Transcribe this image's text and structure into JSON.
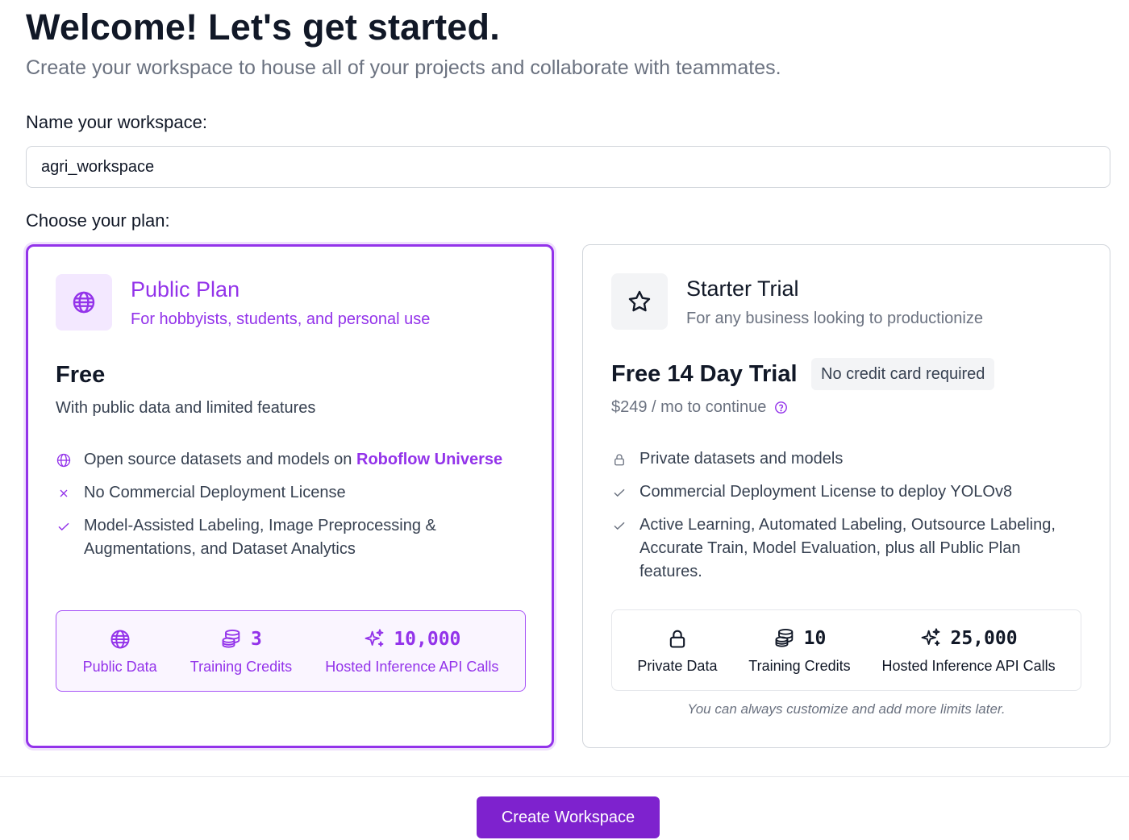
{
  "header": {
    "title": "Welcome! Let's get started.",
    "subtitle": "Create your workspace to house all of your projects and collaborate with teammates."
  },
  "workspace": {
    "label": "Name your workspace:",
    "value": "agri_workspace"
  },
  "plan_label": "Choose your plan:",
  "plans": [
    {
      "name": "Public Plan",
      "description": "For hobbyists, students, and personal use",
      "icon": "globe-icon",
      "price": "Free",
      "price_sub": "With public data and limited features",
      "selected": true,
      "features": [
        {
          "icon": "globe-icon",
          "text": "Open source datasets and models on ",
          "link": "Roboflow Universe"
        },
        {
          "icon": "x-icon",
          "text": "No Commercial Deployment License"
        },
        {
          "icon": "check-icon",
          "text": "Model-Assisted Labeling, Image Preprocessing & Augmentations, and Dataset Analytics"
        }
      ],
      "stats": [
        {
          "icon": "globe-icon",
          "value": "",
          "label": "Public Data"
        },
        {
          "icon": "coins-icon",
          "value": "3",
          "label": "Training Credits"
        },
        {
          "icon": "sparkles-icon",
          "value": "10,000",
          "label": "Hosted Inference API Calls"
        }
      ]
    },
    {
      "name": "Starter Trial",
      "description": "For any business looking to productionize",
      "icon": "star-icon",
      "price": "Free 14 Day Trial",
      "badge": "No credit card required",
      "price_sub": "$249 / mo to continue",
      "selected": false,
      "features": [
        {
          "icon": "lock-icon",
          "text": "Private datasets and models"
        },
        {
          "icon": "check-icon",
          "text": "Commercial Deployment License to deploy YOLOv8"
        },
        {
          "icon": "check-icon",
          "text": "Active Learning, Automated Labeling, Outsource Labeling, Accurate Train, Model Evaluation, plus all Public Plan features."
        }
      ],
      "stats": [
        {
          "icon": "lock-icon",
          "value": "",
          "label": "Private Data"
        },
        {
          "icon": "coins-icon",
          "value": "10",
          "label": "Training Credits"
        },
        {
          "icon": "sparkles-icon",
          "value": "25,000",
          "label": "Hosted Inference API Calls"
        }
      ],
      "footnote": "You can always customize and add more limits later."
    }
  ],
  "create_button": "Create Workspace",
  "colors": {
    "accent": "#9333ea",
    "button": "#7e22ce",
    "muted": "#6b7280"
  }
}
